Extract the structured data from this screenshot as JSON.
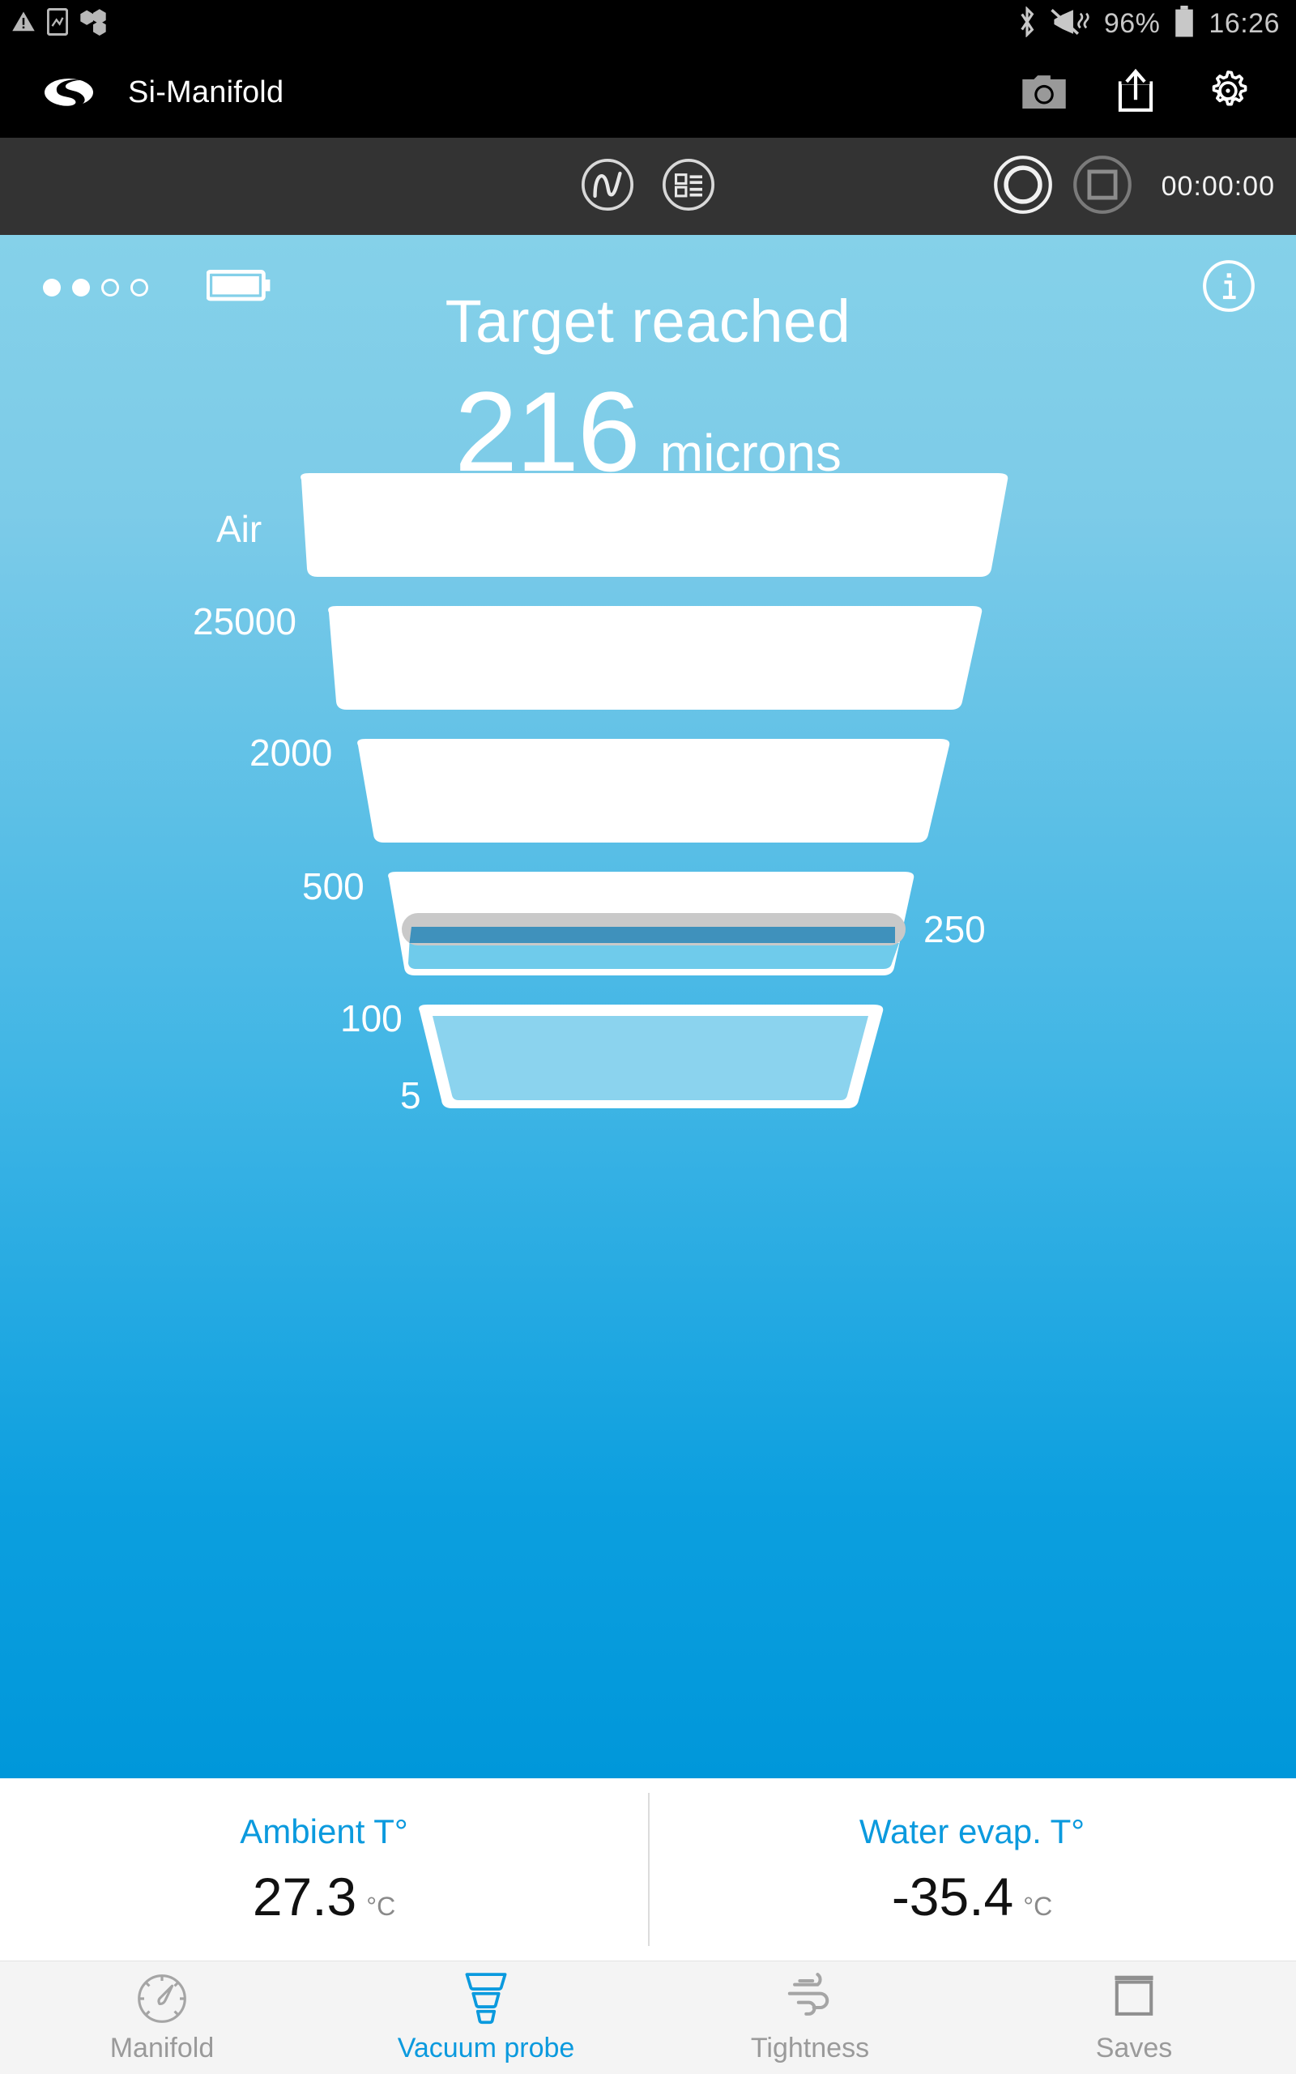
{
  "status_bar": {
    "battery_percent": "96%",
    "time": "16:26",
    "icons": [
      "warning-triangle-icon",
      "screenshot-icon",
      "molecule-icon",
      "bluetooth-icon",
      "vibrate-off-icon",
      "battery-icon"
    ]
  },
  "app_bar": {
    "title": "Si-Manifold",
    "logo": "si-logo",
    "actions": [
      "camera-icon",
      "share-icon",
      "gear-icon"
    ]
  },
  "toolbar": {
    "graph_button": "waveform-icon",
    "list_button": "list-icon",
    "record_button": "record-icon",
    "stop_button": "stop-icon",
    "timer": "00:00:00"
  },
  "main": {
    "page_dots": [
      "filled",
      "filled",
      "hollow",
      "hollow"
    ],
    "battery_indicator": "battery-full-icon",
    "info_button": "info-icon",
    "headline": "Target reached",
    "reading_value": "216",
    "reading_unit": "microns"
  },
  "chart_data": {
    "type": "funnel",
    "title": "Vacuum level funnel",
    "unit": "microns",
    "current_value": 216,
    "marker_label": "250",
    "left_labels": [
      "Air",
      "25000",
      "2000",
      "500",
      "100",
      "5"
    ],
    "right_labels": [
      "250"
    ],
    "segments": [
      {
        "label": "Air",
        "top_scale": "Air",
        "bottom_scale": "25000",
        "fill": "empty"
      },
      {
        "label": "25000",
        "top_scale": "25000",
        "bottom_scale": "2000",
        "fill": "empty"
      },
      {
        "label": "2000",
        "top_scale": "2000",
        "bottom_scale": "500",
        "fill": "empty"
      },
      {
        "label": "500",
        "top_scale": "500",
        "bottom_scale": "100",
        "fill": "partial",
        "marker": "250"
      },
      {
        "label": "100",
        "top_scale": "100",
        "bottom_scale": "5",
        "fill": "full"
      }
    ]
  },
  "temperatures": [
    {
      "label": "Ambient T°",
      "value": "27.3",
      "unit": "°C"
    },
    {
      "label": "Water evap. T°",
      "value": "-35.4",
      "unit": "°C"
    }
  ],
  "bottom_nav": [
    {
      "label": "Manifold",
      "icon": "gauge-icon",
      "active": false
    },
    {
      "label": "Vacuum probe",
      "icon": "funnel-icon",
      "active": true
    },
    {
      "label": "Tightness",
      "icon": "airflow-icon",
      "active": false
    },
    {
      "label": "Saves",
      "icon": "archive-icon",
      "active": false
    }
  ],
  "colors": {
    "accent": "#0b9ade",
    "gradient_top": "#85d1e9",
    "gradient_bottom": "#0097da",
    "marker_gray": "#c9c9c9",
    "marker_line": "#3f91bc",
    "fill_blue": "#6fcbeb"
  }
}
